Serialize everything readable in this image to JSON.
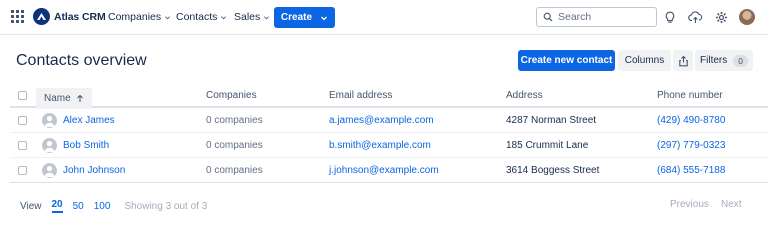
{
  "topnav": {
    "brand": "Atlas CRM",
    "items": [
      {
        "label": "Companies"
      },
      {
        "label": "Contacts"
      },
      {
        "label": "Sales"
      }
    ],
    "create_label": "Create",
    "search_placeholder": "Search",
    "icons": [
      "app-switcher-icon",
      "lightbulb-icon",
      "cloud-upload-icon",
      "settings-icon",
      "avatar"
    ]
  },
  "page": {
    "title": "Contacts overview",
    "actions": {
      "create_contact": "Create new contact",
      "columns": "Columns",
      "filters": "Filters",
      "filters_count": "0"
    }
  },
  "table": {
    "columns": [
      "Name",
      "Companies",
      "Email address",
      "Address",
      "Phone number"
    ],
    "rows": [
      {
        "name": "Alex James",
        "companies": "0 companies",
        "email": "a.james@example.com",
        "address": "4287 Norman Street",
        "phone": "(429) 490-8780"
      },
      {
        "name": "Bob Smith",
        "companies": "0 companies",
        "email": "b.smith@example.com",
        "address": "185 Crummit Lane",
        "phone": "(297) 779-0323"
      },
      {
        "name": "John Johnson",
        "companies": "0 companies",
        "email": "j.johnson@example.com",
        "address": "3614 Boggess Street",
        "phone": "(684) 555-7188"
      }
    ]
  },
  "footer": {
    "view_label": "View",
    "page_sizes": [
      "20",
      "50",
      "100"
    ],
    "active_page_size": "20",
    "showing": "Showing 3 out of 3",
    "previous": "Previous",
    "next": "Next"
  },
  "colors": {
    "primary": "#0c66e4",
    "brand_logo": "#0c3278",
    "text": "#172b4d",
    "muted": "#626f86"
  }
}
